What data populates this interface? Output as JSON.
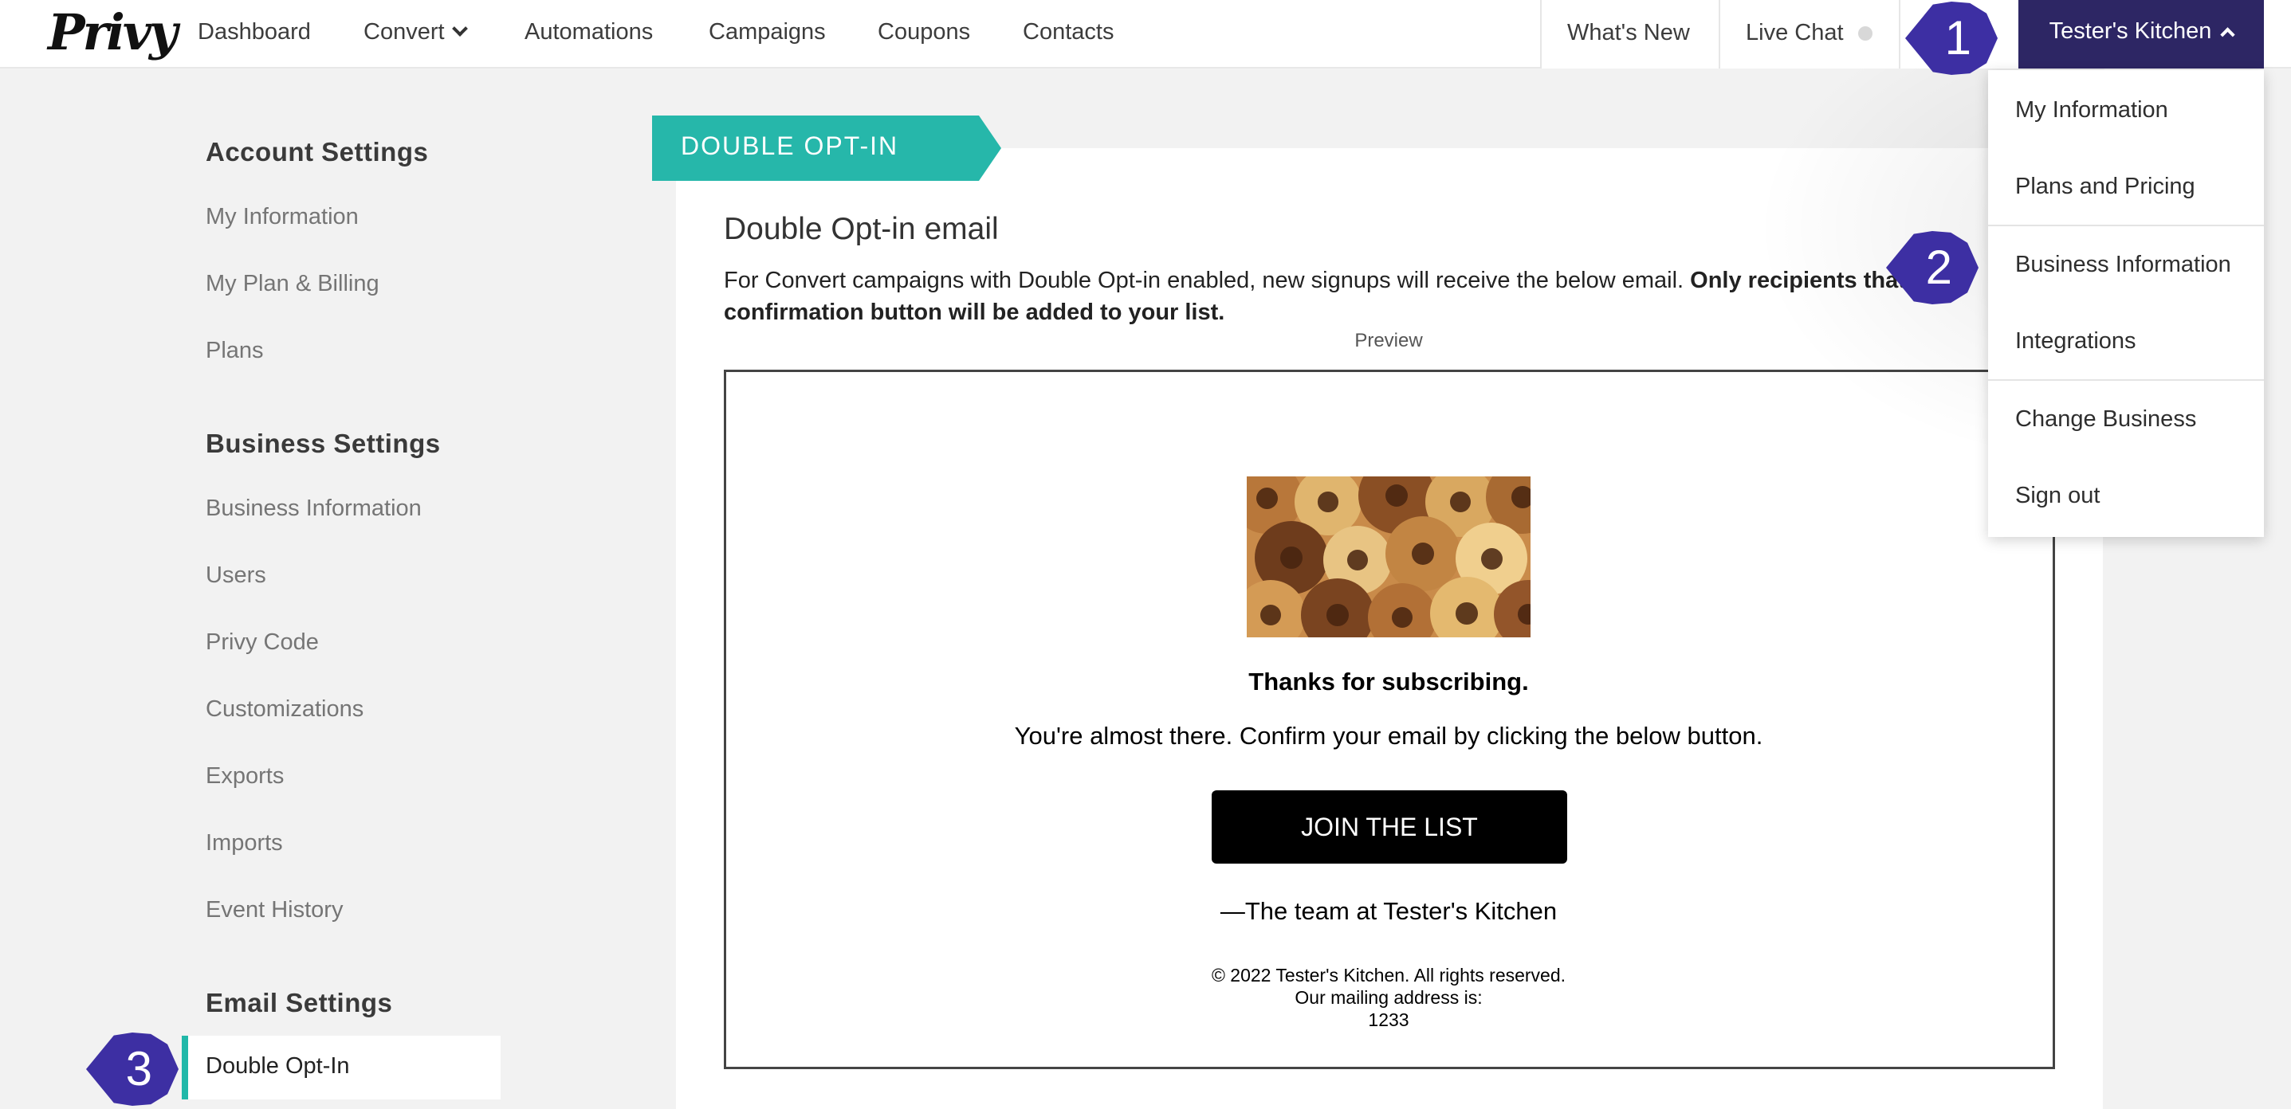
{
  "topnav": {
    "logo": "Privy",
    "items": [
      "Dashboard",
      "Convert",
      "Automations",
      "Campaigns",
      "Coupons",
      "Contacts"
    ],
    "whats_new": "What's New",
    "live_chat": "Live Chat",
    "account": "Tester's Kitchen"
  },
  "account_menu": {
    "items": [
      "My Information",
      "Plans and Pricing",
      "Business Information",
      "Integrations",
      "Change Business",
      "Sign out"
    ]
  },
  "sidebar": {
    "account_settings": {
      "heading": "Account Settings",
      "items": [
        "My Information",
        "My Plan & Billing",
        "Plans"
      ]
    },
    "business_settings": {
      "heading": "Business Settings",
      "items": [
        "Business Information",
        "Users",
        "Privy Code",
        "Customizations",
        "Exports",
        "Imports",
        "Event History"
      ]
    },
    "email_settings": {
      "heading": "Email Settings",
      "active_item": "Double Opt-In"
    }
  },
  "main": {
    "ribbon": "DOUBLE OPT-IN",
    "title": "Double Opt-in email",
    "description_plain": "For Convert campaigns with Double Opt-in enabled, new signups will receive the below email. ",
    "description_bold": "Only recipients that click confirmation button will be added to your list.",
    "preview_label": "Preview"
  },
  "email_preview": {
    "image": "bagels-photo",
    "thanks": "Thanks for subscribing.",
    "message": "You're almost there. Confirm your email by clicking the below button.",
    "button": "JOIN THE LIST",
    "signature": "—The team at Tester's Kitchen",
    "footer_line1": "© 2022 Tester's Kitchen. All rights reserved.",
    "footer_line2": "Our mailing address is:",
    "footer_line3": "1233"
  },
  "markers": [
    "1",
    "2",
    "3"
  ],
  "colors": {
    "brand_teal": "#26b7aa",
    "account_purple": "#2d2664",
    "marker_purple": "#3d2fa3"
  }
}
